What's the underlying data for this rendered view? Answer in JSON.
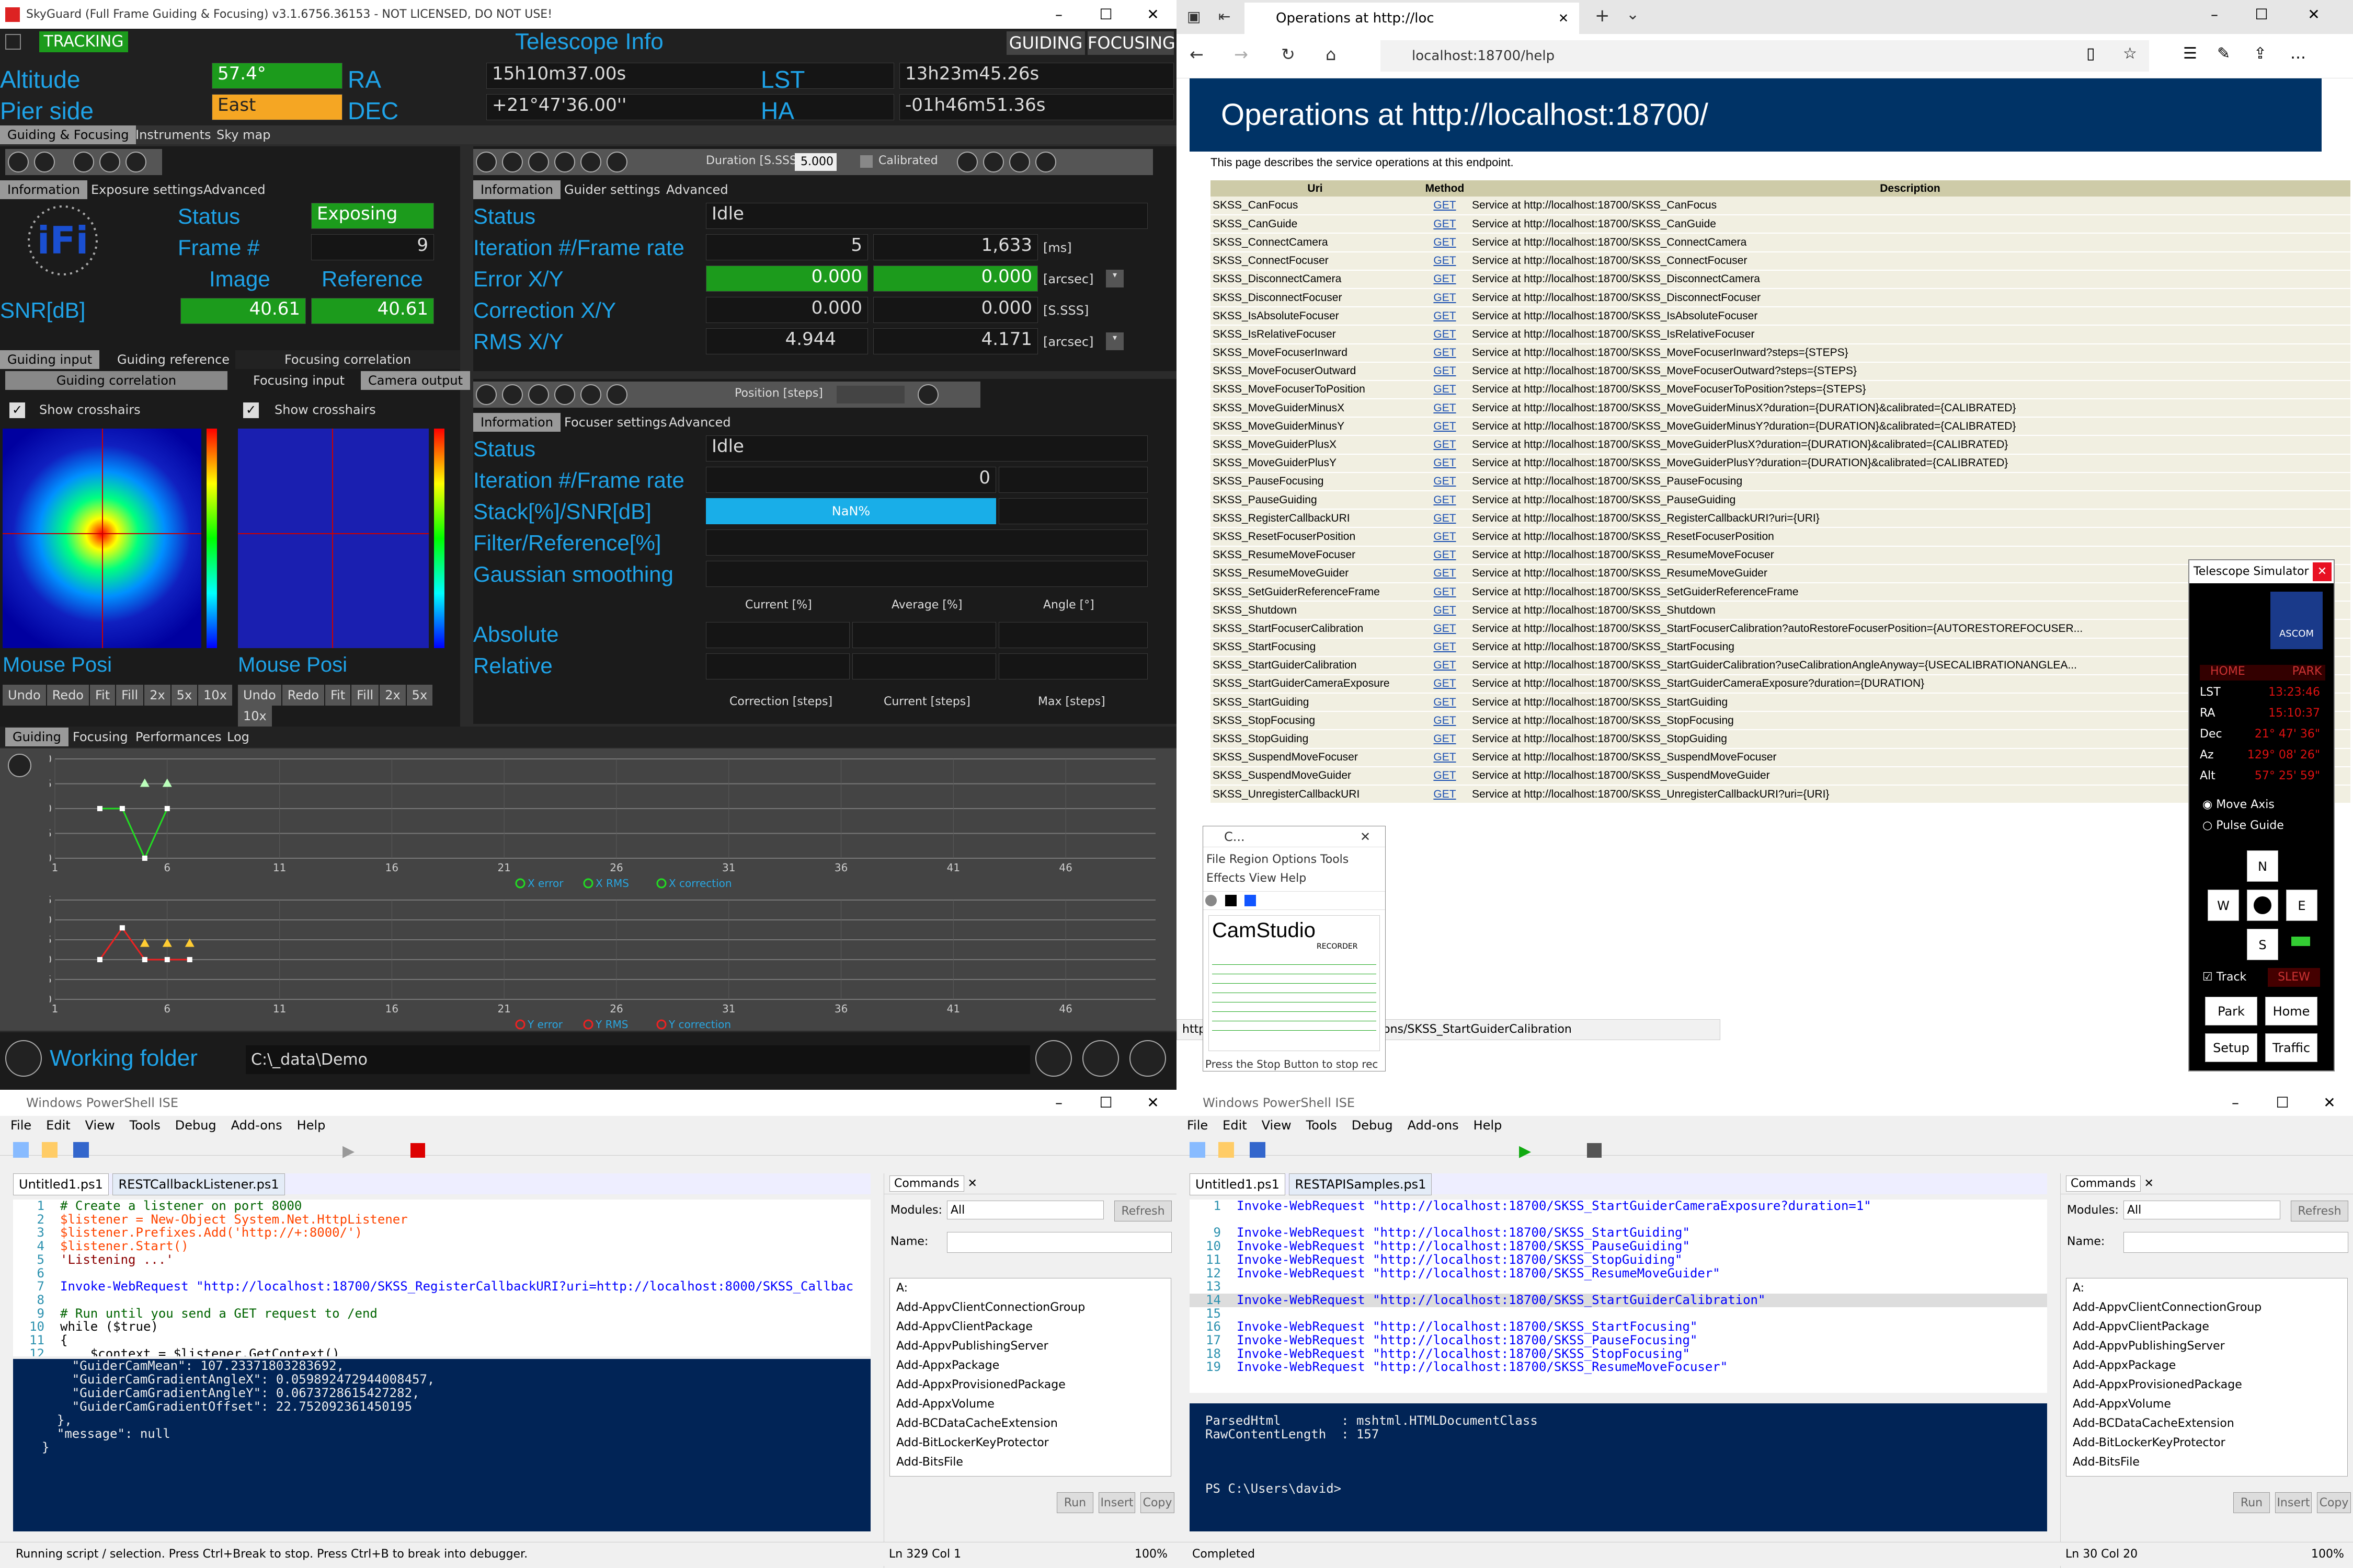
{
  "skyguard": {
    "window_title": "SkyGuard (Full Frame Guiding & Focusing) v3.1.6756.36153 - NOT LICENSED, DO NOT USE!",
    "tracking": "TRACKING",
    "telescope_info": "Telescope Info",
    "guiding_btn": "GUIDING",
    "focusing_btn": "FOCUSING",
    "altitude_label": "Altitude",
    "altitude": "57.4°",
    "pier_label": "Pier side",
    "pier": "East",
    "ra_label": "RA",
    "ra": "15h10m37.00s",
    "dec_label": "DEC",
    "dec": "+21°47'36.00''",
    "lst_label": "LST",
    "lst": "13h23m45.26s",
    "ha_label": "HA",
    "ha": "-01h46m51.36s",
    "main_tabs": [
      "Guiding & Focusing",
      "Instruments",
      "Sky map"
    ],
    "cam_tabs": [
      "Information",
      "Exposure settings",
      "Advanced"
    ],
    "status_label": "Status",
    "status_value": "Exposing",
    "frame_label": "Frame #",
    "frame_value": "9",
    "image_label": "Image",
    "reference_label": "Reference",
    "snr_label": "SNR[dB]",
    "snr_image": "40.61",
    "snr_ref": "40.61",
    "guider_tabs": [
      "Information",
      "Guider settings",
      "Advanced"
    ],
    "duration_label": "Duration [S.SSS]:",
    "duration_value": "5.000",
    "calibrated": "Calibrated",
    "g_status_label": "Status",
    "g_status": "Idle",
    "iter_label": "Iteration #/Frame rate",
    "iter_a": "5",
    "iter_b": "1,633",
    "unit_ms": "[ms]",
    "error_label": "Error X/Y",
    "err_x": "0.000",
    "err_y": "0.000",
    "unit_arcsec": "[arcsec]",
    "corr_label": "Correction X/Y",
    "corr_x": "0.000",
    "corr_y": "0.000",
    "unit_sss": "[S.SSS]",
    "rms_label": "RMS X/Y",
    "rms_x": "4.944",
    "rms_y": "4.171",
    "unit_arcsec2": "[arcsec]",
    "guiding_input": "Guiding input",
    "guiding_reference": "Guiding reference",
    "guiding_correlation": "Guiding correlation",
    "focusing_correlation": "Focusing correlation",
    "focusing_input": "Focusing input",
    "camera_output": "Camera output",
    "show_crosshairs": "Show crosshairs",
    "mouse_pos": "Mouse Posi",
    "view_buttons": [
      "Undo",
      "Redo",
      "Fit",
      "Fill",
      "2x",
      "5x",
      "10x"
    ],
    "focuser_tabs": [
      "Information",
      "Focuser settings",
      "Advanced"
    ],
    "position_label": "Position [steps]",
    "f_status_label": "Status",
    "f_status": "Idle",
    "f_iter_label": "Iteration #/Frame rate",
    "f_iter": "0",
    "stack_label": "Stack[%]/SNR[dB]",
    "stack_value": "NaN%",
    "filter_label": "Filter/Reference[%]",
    "gauss_label": "Gaussian smoothing",
    "col_current": "Current [%]",
    "col_average": "Average [%]",
    "col_angle": "Angle [°]",
    "absolute_label": "Absolute",
    "relative_label": "Relative",
    "col_correction_steps": "Correction [steps]",
    "col_current_steps": "Current [steps]",
    "col_max_steps": "Max [steps]",
    "bottom_tabs": [
      "Guiding",
      "Focusing",
      "Performances",
      "Log"
    ],
    "x_ticks": [
      "1",
      "6",
      "11",
      "16",
      "21",
      "26",
      "31",
      "36",
      "41",
      "46"
    ],
    "y_ticks_top": [
      "10",
      "5",
      "0",
      "-5",
      "-10"
    ],
    "y_ticks_bot": [
      "15",
      "10",
      "5",
      "0",
      "-5",
      "-10"
    ],
    "legend_top": [
      "X error",
      "X RMS",
      "X correction"
    ],
    "legend_bot": [
      "Y error",
      "Y RMS",
      "Y correction"
    ],
    "working_folder_label": "Working folder",
    "working_folder": "C:\\_data\\Demo"
  },
  "browser": {
    "tab_title": "Operations at http://loc",
    "url": "localhost:18700/help",
    "heading": "Operations at http://localhost:18700/",
    "intro": "This page describes the service operations at this endpoint.",
    "col_uri": "Uri",
    "col_method": "Method",
    "col_desc": "Description",
    "status_url": "http://localhost:18700/help/operations/SKSS_StartGuiderCalibration",
    "rows": [
      {
        "uri": "SKSS_CanFocus",
        "m": "GET",
        "d": "Service at http://localhost:18700/SKSS_CanFocus"
      },
      {
        "uri": "SKSS_CanGuide",
        "m": "GET",
        "d": "Service at http://localhost:18700/SKSS_CanGuide"
      },
      {
        "uri": "SKSS_ConnectCamera",
        "m": "GET",
        "d": "Service at http://localhost:18700/SKSS_ConnectCamera"
      },
      {
        "uri": "SKSS_ConnectFocuser",
        "m": "GET",
        "d": "Service at http://localhost:18700/SKSS_ConnectFocuser"
      },
      {
        "uri": "SKSS_DisconnectCamera",
        "m": "GET",
        "d": "Service at http://localhost:18700/SKSS_DisconnectCamera"
      },
      {
        "uri": "SKSS_DisconnectFocuser",
        "m": "GET",
        "d": "Service at http://localhost:18700/SKSS_DisconnectFocuser"
      },
      {
        "uri": "SKSS_IsAbsoluteFocuser",
        "m": "GET",
        "d": "Service at http://localhost:18700/SKSS_IsAbsoluteFocuser"
      },
      {
        "uri": "SKSS_IsRelativeFocuser",
        "m": "GET",
        "d": "Service at http://localhost:18700/SKSS_IsRelativeFocuser"
      },
      {
        "uri": "SKSS_MoveFocuserInward",
        "m": "GET",
        "d": "Service at http://localhost:18700/SKSS_MoveFocuserInward?steps={STEPS}"
      },
      {
        "uri": "SKSS_MoveFocuserOutward",
        "m": "GET",
        "d": "Service at http://localhost:18700/SKSS_MoveFocuserOutward?steps={STEPS}"
      },
      {
        "uri": "SKSS_MoveFocuserToPosition",
        "m": "GET",
        "d": "Service at http://localhost:18700/SKSS_MoveFocuserToPosition?steps={STEPS}"
      },
      {
        "uri": "SKSS_MoveGuiderMinusX",
        "m": "GET",
        "d": "Service at http://localhost:18700/SKSS_MoveGuiderMinusX?duration={DURATION}&calibrated={CALIBRATED}"
      },
      {
        "uri": "SKSS_MoveGuiderMinusY",
        "m": "GET",
        "d": "Service at http://localhost:18700/SKSS_MoveGuiderMinusY?duration={DURATION}&calibrated={CALIBRATED}"
      },
      {
        "uri": "SKSS_MoveGuiderPlusX",
        "m": "GET",
        "d": "Service at http://localhost:18700/SKSS_MoveGuiderPlusX?duration={DURATION}&calibrated={CALIBRATED}"
      },
      {
        "uri": "SKSS_MoveGuiderPlusY",
        "m": "GET",
        "d": "Service at http://localhost:18700/SKSS_MoveGuiderPlusY?duration={DURATION}&calibrated={CALIBRATED}"
      },
      {
        "uri": "SKSS_PauseFocusing",
        "m": "GET",
        "d": "Service at http://localhost:18700/SKSS_PauseFocusing"
      },
      {
        "uri": "SKSS_PauseGuiding",
        "m": "GET",
        "d": "Service at http://localhost:18700/SKSS_PauseGuiding"
      },
      {
        "uri": "SKSS_RegisterCallbackURI",
        "m": "GET",
        "d": "Service at http://localhost:18700/SKSS_RegisterCallbackURI?uri={URI}"
      },
      {
        "uri": "SKSS_ResetFocuserPosition",
        "m": "GET",
        "d": "Service at http://localhost:18700/SKSS_ResetFocuserPosition"
      },
      {
        "uri": "SKSS_ResumeMoveFocuser",
        "m": "GET",
        "d": "Service at http://localhost:18700/SKSS_ResumeMoveFocuser"
      },
      {
        "uri": "SKSS_ResumeMoveGuider",
        "m": "GET",
        "d": "Service at http://localhost:18700/SKSS_ResumeMoveGuider"
      },
      {
        "uri": "SKSS_SetGuiderReferenceFrame",
        "m": "GET",
        "d": "Service at http://localhost:18700/SKSS_SetGuiderReferenceFrame"
      },
      {
        "uri": "SKSS_Shutdown",
        "m": "GET",
        "d": "Service at http://localhost:18700/SKSS_Shutdown"
      },
      {
        "uri": "SKSS_StartFocuserCalibration",
        "m": "GET",
        "d": "Service at http://localhost:18700/SKSS_StartFocuserCalibration?autoRestoreFocuserPosition={AUTORESTOREFOCUSER..."
      },
      {
        "uri": "SKSS_StartFocusing",
        "m": "GET",
        "d": "Service at http://localhost:18700/SKSS_StartFocusing"
      },
      {
        "uri": "SKSS_StartGuiderCalibration",
        "m": "GET",
        "d": "Service at http://localhost:18700/SKSS_StartGuiderCalibration?useCalibrationAngleAnyway={USECALIBRATIONANGLEA..."
      },
      {
        "uri": "SKSS_StartGuiderCameraExposure",
        "m": "GET",
        "d": "Service at http://localhost:18700/SKSS_StartGuiderCameraExposure?duration={DURATION}"
      },
      {
        "uri": "SKSS_StartGuiding",
        "m": "GET",
        "d": "Service at http://localhost:18700/SKSS_StartGuiding"
      },
      {
        "uri": "SKSS_StopFocusing",
        "m": "GET",
        "d": "Service at http://localhost:18700/SKSS_StopFocusing"
      },
      {
        "uri": "SKSS_StopGuiding",
        "m": "GET",
        "d": "Service at http://localhost:18700/SKSS_StopGuiding"
      },
      {
        "uri": "SKSS_SuspendMoveFocuser",
        "m": "GET",
        "d": "Service at http://localhost:18700/SKSS_SuspendMoveFocuser"
      },
      {
        "uri": "SKSS_SuspendMoveGuider",
        "m": "GET",
        "d": "Service at http://localhost:18700/SKSS_SuspendMoveGuider"
      },
      {
        "uri": "SKSS_UnregisterCallbackURI",
        "m": "GET",
        "d": "Service at http://localhost:18700/SKSS_UnregisterCallbackURI?uri={URI}"
      }
    ]
  },
  "sim": {
    "title": "Telescope Simulator",
    "home": "HOME",
    "park": "PARK",
    "lst_label": "LST",
    "lst": "13:23:46",
    "ra_label": "RA",
    "ra": "15:10:37",
    "dec_label": "Dec",
    "dec": "21° 47' 36\"",
    "az_label": "Az",
    "az": "129° 08' 26\"",
    "alt_label": "Alt",
    "alt": "57° 25' 59\"",
    "move_axis": "Move Axis",
    "pulse_guide": "Pulse Guide",
    "n": "N",
    "w": "W",
    "e": "E",
    "s": "S",
    "track": "Track",
    "slew": "SLEW",
    "park_btn": "Park",
    "home_btn": "Home",
    "setup_btn": "Setup",
    "traffic_btn": "Traffic"
  },
  "camstudio": {
    "title": "C...",
    "menu": [
      "File",
      "Region",
      "Options",
      "Tools",
      "Effects",
      "View",
      "Help"
    ],
    "logo": "CamStudio",
    "logo_sub": "RECORDER",
    "status": "Press the Stop Button to stop rec"
  },
  "ps_left": {
    "title": "Windows PowerShell ISE",
    "menu": [
      "File",
      "Edit",
      "View",
      "Tools",
      "Debug",
      "Add-ons",
      "Help"
    ],
    "tabs": [
      "Untitled1.ps1",
      "RESTCallbackListener.ps1"
    ],
    "code": [
      {
        "n": "1",
        "t": "# Create a listener on port 8000"
      },
      {
        "n": "2",
        "t": "$listener = New-Object System.Net.HttpListener"
      },
      {
        "n": "3",
        "t": "$listener.Prefixes.Add('http://+:8000/')"
      },
      {
        "n": "4",
        "t": "$listener.Start()"
      },
      {
        "n": "5",
        "t": "'Listening ...'"
      },
      {
        "n": "6",
        "t": ""
      },
      {
        "n": "7",
        "t": "Invoke-WebRequest \"http://localhost:18700/SKSS_RegisterCallbackURI?uri=http://localhost:8000/SKSS_Callbac"
      },
      {
        "n": "8",
        "t": ""
      },
      {
        "n": "9",
        "t": "# Run until you send a GET request to /end"
      },
      {
        "n": "10",
        "t": "while ($true)"
      },
      {
        "n": "11",
        "t": "{"
      },
      {
        "n": "12",
        "t": "    $context = $listener.GetContext()"
      }
    ],
    "console": "    \"GuiderCamMean\": 107.23371803283692,\n    \"GuiderCamGradientAngleX\": 0.059892472944008457,\n    \"GuiderCamGradientAngleY\": 0.0673728615427282,\n    \"GuiderCamGradientOffset\": 22.752092361450195\n  },\n  \"message\": null\n}",
    "status": "Running script / selection.  Press Ctrl+Break to stop.  Press Ctrl+B to break into debugger.",
    "pos": "Ln 329  Col 1",
    "zoom": "100%"
  },
  "ps_right": {
    "title": "Windows PowerShell ISE",
    "menu": [
      "File",
      "Edit",
      "View",
      "Tools",
      "Debug",
      "Add-ons",
      "Help"
    ],
    "tabs": [
      "Untitled1.ps1",
      "RESTAPISamples.ps1"
    ],
    "code": [
      {
        "n": "1",
        "t": "Invoke-WebRequest \"http://localhost:18700/SKSS_StartGuiderCameraExposure?duration=1\""
      },
      {
        "n": "",
        "t": ""
      },
      {
        "n": "9",
        "t": "Invoke-WebRequest \"http://localhost:18700/SKSS_StartGuiding\""
      },
      {
        "n": "10",
        "t": "Invoke-WebRequest \"http://localhost:18700/SKSS_PauseGuiding\""
      },
      {
        "n": "11",
        "t": "Invoke-WebRequest \"http://localhost:18700/SKSS_StopGuiding\""
      },
      {
        "n": "12",
        "t": "Invoke-WebRequest \"http://localhost:18700/SKSS_ResumeMoveGuider\""
      },
      {
        "n": "13",
        "t": ""
      },
      {
        "n": "14",
        "t": "Invoke-WebRequest \"http://localhost:18700/SKSS_StartGuiderCalibration\""
      },
      {
        "n": "15",
        "t": ""
      },
      {
        "n": "16",
        "t": "Invoke-WebRequest \"http://localhost:18700/SKSS_StartFocusing\""
      },
      {
        "n": "17",
        "t": "Invoke-WebRequest \"http://localhost:18700/SKSS_PauseFocusing\""
      },
      {
        "n": "18",
        "t": "Invoke-WebRequest \"http://localhost:18700/SKSS_StopFocusing\""
      },
      {
        "n": "19",
        "t": "Invoke-WebRequest \"http://localhost:18700/SKSS_ResumeMoveFocuser\""
      }
    ],
    "console": "ParsedHtml        : mshtml.HTMLDocumentClass\nRawContentLength  : 157\n\n\n\nPS C:\\Users\\david>",
    "status": "Completed",
    "pos": "Ln 30  Col 20",
    "zoom": "100%"
  },
  "commands": {
    "title": "Commands",
    "modules_label": "Modules:",
    "modules_value": "All",
    "refresh": "Refresh",
    "name_label": "Name:",
    "items": [
      "A:",
      "Add-AppvClientConnectionGroup",
      "Add-AppvClientPackage",
      "Add-AppvPublishingServer",
      "Add-AppxPackage",
      "Add-AppxProvisionedPackage",
      "Add-AppxVolume",
      "Add-BCDataCacheExtension",
      "Add-BitLockerKeyProtector",
      "Add-BitsFile"
    ],
    "run": "Run",
    "insert": "Insert",
    "copy": "Copy"
  }
}
